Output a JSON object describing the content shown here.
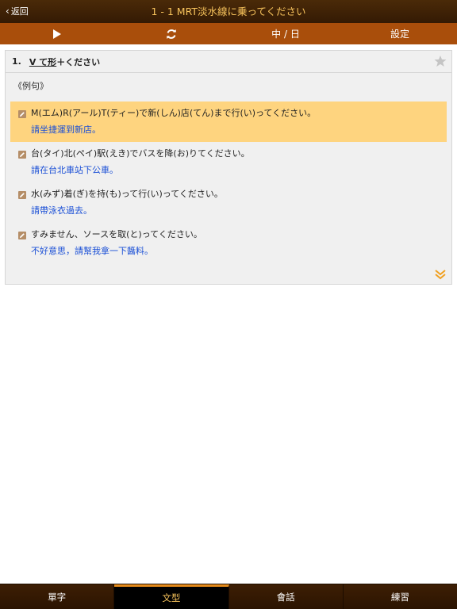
{
  "navbar": {
    "back_label": "返回",
    "title": "1 - 1 MRT淡水線に乗ってください"
  },
  "toolbar": {
    "play_icon": "play-icon",
    "refresh_icon": "refresh-icon",
    "language_label": "中 / 日",
    "settings_label": "設定"
  },
  "grammar": {
    "number": "1.",
    "pattern_underlined": "V て形",
    "pattern_rest": "＋ください",
    "section_label": "《例句》",
    "examples": [
      {
        "jp": "M(エム)R(アール)T(ティー)で新(しん)店(てん)まで行(い)ってください。",
        "zh": "請坐捷運到新店。"
      },
      {
        "jp": "台(タイ)北(ペイ)駅(えき)でバスを降(お)りてください。",
        "zh": "請在台北車站下公車。"
      },
      {
        "jp": "水(みず)着(ぎ)を持(も)って行(い)ってください。",
        "zh": "請帶泳衣過去。"
      },
      {
        "jp": "すみません、ソースを取(と)ってください。",
        "zh": "不好意思，請幫我拿一下醬料。"
      }
    ]
  },
  "tabs": [
    {
      "label": "單字"
    },
    {
      "label": "文型"
    },
    {
      "label": "會話"
    },
    {
      "label": "練習"
    }
  ],
  "colors": {
    "navbar": "#3f2006",
    "toolbar": "#a94e0b",
    "title_accent": "#f7c35c",
    "highlight": "#fed47f",
    "translation": "#1a4fd6"
  }
}
